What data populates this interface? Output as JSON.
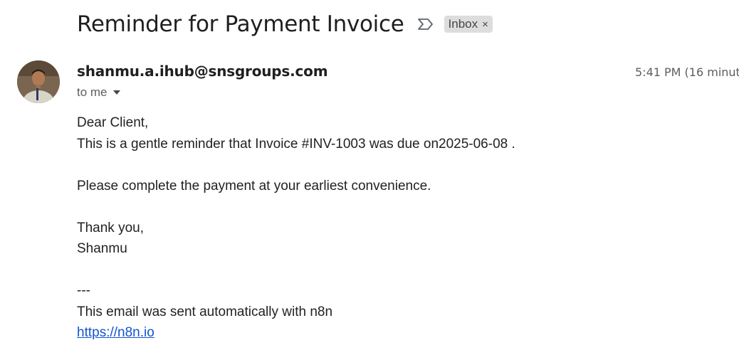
{
  "email": {
    "subject": "Reminder for Payment Invoice",
    "label": "Inbox",
    "label_remove": "×",
    "sender": "shanmu.a.ihub@snsgroups.com",
    "timestamp": "5:41 PM (16 minute",
    "recipient": "to me",
    "body_lines": [
      "Dear Client,",
      "This is a gentle reminder that Invoice #INV-1003 was due on2025-06-08 .",
      "",
      "Please complete the payment at your earliest convenience.",
      "",
      "Thank you,",
      "Shanmu",
      "",
      "---",
      "This email was sent automatically with n8n"
    ],
    "link": "https://n8n.io"
  },
  "icons": {
    "important": "important-marker-icon",
    "label_close": "close-icon",
    "recipient_details": "chevron-down-icon"
  }
}
